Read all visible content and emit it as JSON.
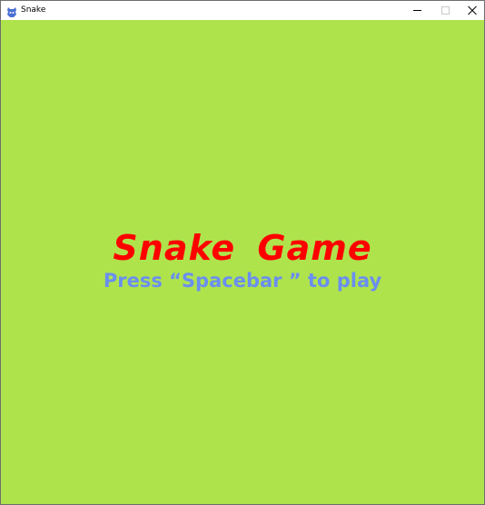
{
  "window": {
    "title": "Snake",
    "app_icon": "snake-app-icon",
    "controls": {
      "minimize": "minimize-icon",
      "maximize": "maximize-icon",
      "close": "close-icon"
    }
  },
  "game": {
    "title": "Snake  Game",
    "prompt": "Press “Spacebar ” to play",
    "colors": {
      "background": "#afe34c",
      "title": "#ff0000",
      "prompt": "#6a8ef0"
    }
  }
}
